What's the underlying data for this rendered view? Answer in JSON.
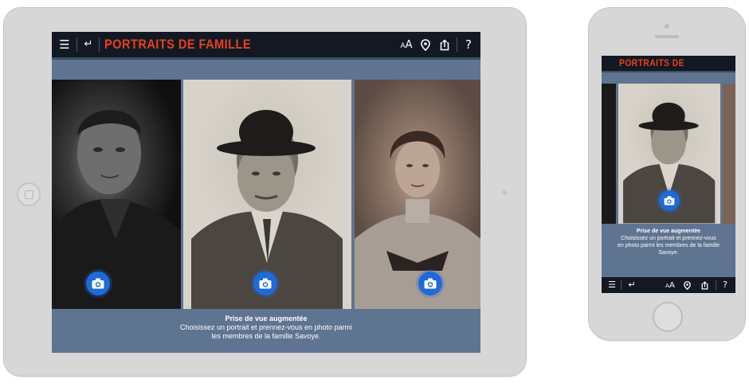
{
  "app": {
    "title": "PORTRAITS DE FAMILLE"
  },
  "toolbar": {
    "menu_icon": "☰",
    "back_icon": "↵",
    "font_size_label": "AA",
    "location_icon": "map-pin",
    "share_icon": "share",
    "help_label": "?"
  },
  "portraits": [
    {
      "name": "portrait-man-dark-suit"
    },
    {
      "name": "portrait-man-bowler-hat"
    },
    {
      "name": "portrait-woman-vintage"
    }
  ],
  "caption": {
    "title": "Prise de vue augmentée",
    "tablet_line1": "Choisissez un portrait et prennez-vous en photo parmi",
    "tablet_line2": "les membres de la famille Savoye.",
    "phone_line1": "Choisissez un portrait et prennez-vous",
    "phone_line2": "en photo parmi les membres de la famille",
    "phone_line3": "Savoye."
  },
  "colors": {
    "accent": "#e8401e",
    "camera_button": "#1e6ad8",
    "bar": "#121923",
    "screen_bg": "#5f7491"
  }
}
